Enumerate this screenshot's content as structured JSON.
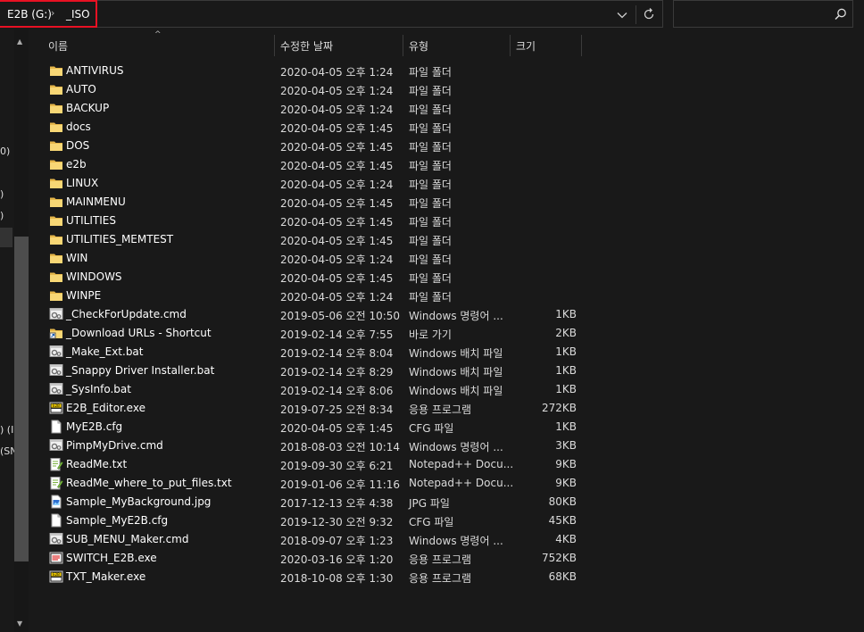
{
  "address": {
    "drive": "E2B (G:)",
    "separator": "›",
    "folder": "_ISO"
  },
  "search": {
    "placeholder": ""
  },
  "nav_fragments": [
    "0)",
    ")",
    ")",
    ") (I",
    "(SN"
  ],
  "columns": {
    "name": "이름",
    "date": "수정한 날짜",
    "type": "유형",
    "size": "크기"
  },
  "files": [
    {
      "name": "ANTIVIRUS",
      "date": "2020-04-05 오후 1:24",
      "type": "파일 폴더",
      "size": "",
      "icon": "folder-icon"
    },
    {
      "name": "AUTO",
      "date": "2020-04-05 오후 1:24",
      "type": "파일 폴더",
      "size": "",
      "icon": "folder-icon"
    },
    {
      "name": "BACKUP",
      "date": "2020-04-05 오후 1:24",
      "type": "파일 폴더",
      "size": "",
      "icon": "folder-icon"
    },
    {
      "name": "docs",
      "date": "2020-04-05 오후 1:45",
      "type": "파일 폴더",
      "size": "",
      "icon": "folder-icon"
    },
    {
      "name": "DOS",
      "date": "2020-04-05 오후 1:45",
      "type": "파일 폴더",
      "size": "",
      "icon": "folder-icon"
    },
    {
      "name": "e2b",
      "date": "2020-04-05 오후 1:45",
      "type": "파일 폴더",
      "size": "",
      "icon": "folder-icon"
    },
    {
      "name": "LINUX",
      "date": "2020-04-05 오후 1:24",
      "type": "파일 폴더",
      "size": "",
      "icon": "folder-icon"
    },
    {
      "name": "MAINMENU",
      "date": "2020-04-05 오후 1:45",
      "type": "파일 폴더",
      "size": "",
      "icon": "folder-icon"
    },
    {
      "name": "UTILITIES",
      "date": "2020-04-05 오후 1:45",
      "type": "파일 폴더",
      "size": "",
      "icon": "folder-icon"
    },
    {
      "name": "UTILITIES_MEMTEST",
      "date": "2020-04-05 오후 1:45",
      "type": "파일 폴더",
      "size": "",
      "icon": "folder-icon"
    },
    {
      "name": "WIN",
      "date": "2020-04-05 오후 1:24",
      "type": "파일 폴더",
      "size": "",
      "icon": "folder-icon"
    },
    {
      "name": "WINDOWS",
      "date": "2020-04-05 오후 1:45",
      "type": "파일 폴더",
      "size": "",
      "icon": "folder-icon"
    },
    {
      "name": "WINPE",
      "date": "2020-04-05 오후 1:24",
      "type": "파일 폴더",
      "size": "",
      "icon": "folder-icon"
    },
    {
      "name": "_CheckForUpdate.cmd",
      "date": "2019-05-06 오전 10:50",
      "type": "Windows 명령어 ...",
      "size": "1KB",
      "icon": "script-gear-icon"
    },
    {
      "name": "_Download URLs - Shortcut",
      "date": "2019-02-14 오후 7:55",
      "type": "바로 가기",
      "size": "2KB",
      "icon": "shortcut-icon"
    },
    {
      "name": "_Make_Ext.bat",
      "date": "2019-02-14 오후 8:04",
      "type": "Windows 배치 파일",
      "size": "1KB",
      "icon": "script-gear-icon"
    },
    {
      "name": "_Snappy Driver Installer.bat",
      "date": "2019-02-14 오후 8:29",
      "type": "Windows 배치 파일",
      "size": "1KB",
      "icon": "script-gear-icon"
    },
    {
      "name": "_SysInfo.bat",
      "date": "2019-02-14 오후 8:06",
      "type": "Windows 배치 파일",
      "size": "1KB",
      "icon": "script-gear-icon"
    },
    {
      "name": "E2B_Editor.exe",
      "date": "2019-07-25 오전 8:34",
      "type": "응용 프로그램",
      "size": "272KB",
      "icon": "e2b-exe-icon"
    },
    {
      "name": "MyE2B.cfg",
      "date": "2020-04-05 오후 1:45",
      "type": "CFG 파일",
      "size": "1KB",
      "icon": "document-icon"
    },
    {
      "name": "PimpMyDrive.cmd",
      "date": "2018-08-03 오전 10:14",
      "type": "Windows 명령어 ...",
      "size": "3KB",
      "icon": "script-gear-icon"
    },
    {
      "name": "ReadMe.txt",
      "date": "2019-09-30 오후 6:21",
      "type": "Notepad++ Docu...",
      "size": "9KB",
      "icon": "notepad-icon"
    },
    {
      "name": "ReadMe_where_to_put_files.txt",
      "date": "2019-01-06 오후 11:16",
      "type": "Notepad++ Docu...",
      "size": "9KB",
      "icon": "notepad-icon"
    },
    {
      "name": "Sample_MyBackground.jpg",
      "date": "2017-12-13 오후 4:38",
      "type": "JPG 파일",
      "size": "80KB",
      "icon": "image-icon"
    },
    {
      "name": "Sample_MyE2B.cfg",
      "date": "2019-12-30 오전 9:32",
      "type": "CFG 파일",
      "size": "45KB",
      "icon": "document-icon"
    },
    {
      "name": "SUB_MENU_Maker.cmd",
      "date": "2018-09-07 오후 1:23",
      "type": "Windows 명령어 ...",
      "size": "4KB",
      "icon": "script-gear-icon"
    },
    {
      "name": "SWITCH_E2B.exe",
      "date": "2020-03-16 오후 1:20",
      "type": "응용 프로그램",
      "size": "752KB",
      "icon": "switch-exe-icon"
    },
    {
      "name": "TXT_Maker.exe",
      "date": "2018-10-08 오후 1:30",
      "type": "응용 프로그램",
      "size": "68KB",
      "icon": "e2b-exe-icon"
    }
  ]
}
